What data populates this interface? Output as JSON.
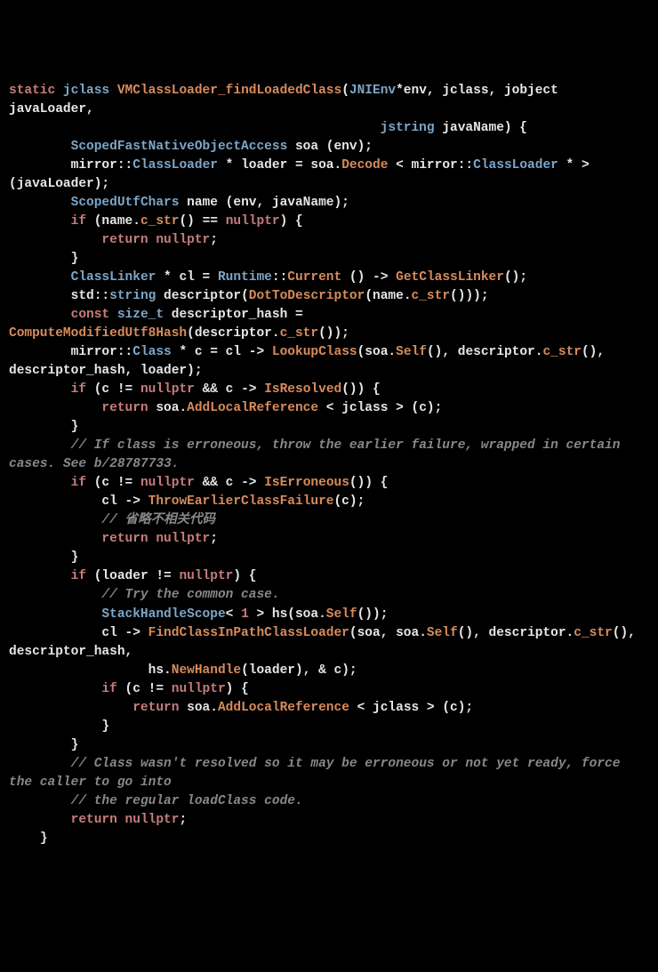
{
  "code": {
    "line1_static": "static",
    "line1_jclass": "jclass",
    "line1_fn": "VMClassLoader_findLoadedClass",
    "line1_jnienv": "JNIEnv",
    "line1_tail": "*env, jclass, jobject javaLoader,",
    "line2_jstring": "jstring",
    "line2_tail": "javaName) {",
    "line3_type": "ScopedFastNativeObjectAccess",
    "line3_tail": " soa (env);",
    "line4a": "mirror::",
    "line4_type": "ClassLoader",
    "line4_mid": " * loader = soa.",
    "line4_fn": "Decode",
    "line4_tail": " < mirror::",
    "line4_type2": "ClassLoader",
    "line4_end": " * > (javaLoader);",
    "line5_type": "ScopedUtfChars",
    "line5_tail": " name (env, javaName);",
    "line6_if": "if",
    "line6_mid": " (name.",
    "line6_fn": "c_str",
    "line6_mid2": "() == ",
    "line6_null": "nullptr",
    "line6_tail": ") {",
    "line7_ret": "return",
    "line7_null": "nullptr",
    "line8_brace": "}",
    "line9_type": "ClassLinker",
    "line9_mid": " * cl = ",
    "line9_type2": "Runtime",
    "line9_mid2": "::",
    "line9_fn": "Current",
    "line9_tail": " () -> ",
    "line9_fn2": "GetClassLinker",
    "line9_end": "();",
    "line10a": "std::",
    "line10_type": "string",
    "line10_tail": " descriptor(",
    "line10_fn": "DotToDescriptor",
    "line10_mid": "(name.",
    "line10_fn2": "c_str",
    "line10_end": "()));",
    "line11_const": "const",
    "line11_type": "size_t",
    "line11_mid": " descriptor_hash = ",
    "line11_fn": "ComputeModifiedUtf8Hash",
    "line11_mid2": "(descriptor.",
    "line11_fn2": "c_str",
    "line11_end": "());",
    "line12a": "mirror::",
    "line12_type": "Class",
    "line12_mid": " * c = cl -> ",
    "line12_fn": "LookupClass",
    "line12_mid2": "(soa.",
    "line12_fn2": "Self",
    "line12_mid3": "(), descriptor.",
    "line12_fn3": "c_str",
    "line12_end": "(), descriptor_hash, loader);",
    "line13_if": "if",
    "line13_mid": " (c != ",
    "line13_null": "nullptr",
    "line13_mid2": " && c -> ",
    "line13_fn": "IsResolved",
    "line13_end": "()) {",
    "line14_ret": "return",
    "line14_mid": " soa.",
    "line14_fn": "AddLocalReference",
    "line14_end": " < jclass > (c);",
    "line15_brace": "}",
    "cmt1": "// If class is erroneous, throw the earlier failure, wrapped in certain cases. See b/28787733.",
    "line17_if": "if",
    "line17_mid": " (c != ",
    "line17_null": "nullptr",
    "line17_mid2": " && c -> ",
    "line17_fn": "IsErroneous",
    "line17_end": "()) {",
    "line18_mid": "cl -> ",
    "line18_fn": "ThrowEarlierClassFailure",
    "line18_end": "(c);",
    "cmt2": "// 省略不相关代码",
    "line20_ret": "return",
    "line20_null": "nullptr",
    "line21_brace": "}",
    "line22_if": "if",
    "line22_mid": " (loader != ",
    "line22_null": "nullptr",
    "line22_end": ") {",
    "cmt3": "// Try the common case.",
    "line24_type": "StackHandleScope",
    "line24_mid": "< ",
    "line24_num": "1",
    "line24_mid2": " > hs(soa.",
    "line24_fn": "Self",
    "line24_end": "());",
    "line25_mid": "cl -> ",
    "line25_fn": "FindClassInPathClassLoader",
    "line25_mid2": "(soa, soa.",
    "line25_fn2": "Self",
    "line25_mid3": "(), descriptor.",
    "line25_fn3": "c_str",
    "line25_end": "(), descriptor_hash,",
    "line26_mid": "hs.",
    "line26_fn": "NewHandle",
    "line26_end": "(loader), & c);",
    "line27_if": "if",
    "line27_mid": " (c != ",
    "line27_null": "nullptr",
    "line27_end": ") {",
    "line28_ret": "return",
    "line28_mid": " soa.",
    "line28_fn": "AddLocalReference",
    "line28_end": " < jclass > (c);",
    "line29_brace": "}",
    "line30_brace": "}",
    "cmt4": "// Class wasn't resolved so it may be erroneous or not yet ready, force the caller to go into",
    "cmt5": "// the regular loadClass code.",
    "line33_ret": "return",
    "line33_null": "nullptr",
    "line34_brace": "}"
  }
}
